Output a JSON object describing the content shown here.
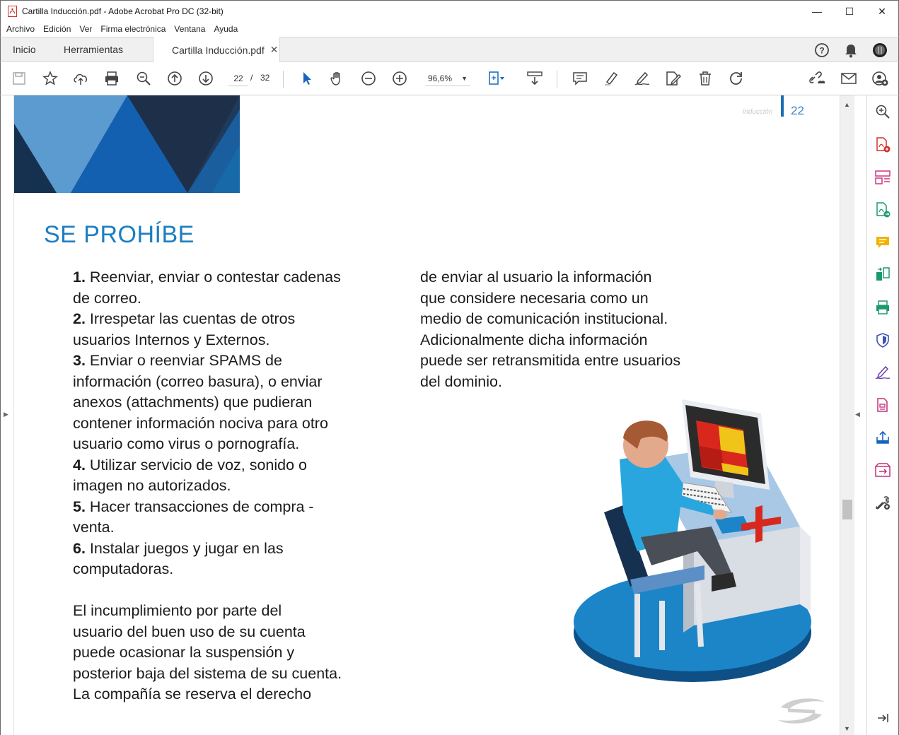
{
  "window": {
    "title": "Cartilla Inducción.pdf - Adobe Acrobat Pro DC (32-bit)",
    "minimize": "—",
    "maximize": "☐",
    "close": "✕"
  },
  "menu": [
    "Archivo",
    "Edición",
    "Ver",
    "Firma electrónica",
    "Ventana",
    "Ayuda"
  ],
  "tabs": {
    "home": "Inicio",
    "tools": "Herramientas",
    "document": "Cartilla Inducción.pdf",
    "close": "✕"
  },
  "toolbar": {
    "current_page": "22",
    "separator": "/",
    "total_pages": "32",
    "zoom": "96,6%",
    "zoom_caret": "▼"
  },
  "page": {
    "header_word": "inducción",
    "page_number": "22",
    "heading": "SE PROHÍBE",
    "list": [
      {
        "num": "1.",
        "text": " Reenviar, enviar o contestar cadenas\nde correo."
      },
      {
        "num": "2.",
        "text": " Irrespetar las cuentas de otros\nusuarios Internos y Externos."
      },
      {
        "num": "3.",
        "text": " Enviar o reenviar SPAMS de\ninformación (correo basura), o enviar\nanexos (attachments) que pudieran\ncontener información nociva para otro\nusuario como virus o pornografía."
      },
      {
        "num": "4.",
        "text": " Utilizar servicio de voz, sonido o\nimagen no autorizados."
      },
      {
        "num": "5.",
        "text": " Hacer transacciones de compra -\nventa."
      },
      {
        "num": "6.",
        "text": " Instalar juegos y jugar en las\ncomputadoras."
      }
    ],
    "closing_left": "El incumplimiento por parte del\nusuario del buen uso de su cuenta\npuede ocasionar la suspensión y\nposterior baja del sistema de su cuenta.\nLa compañía se reserva el derecho",
    "closing_right": "de enviar al usuario la información\nque considere necesaria como un\nmedio de comunicación institucional.\nAdicionalmente dicha información\npuede ser retransmitida entre usuarios\ndel dominio."
  },
  "scroll": {
    "up": "▲",
    "down": "▼",
    "left_collapse": "▶",
    "right_collapse": "◀"
  },
  "colors": {
    "heading": "#1b7ec2",
    "accent": "#1a6fb5",
    "acrobat_red": "#d4302b"
  }
}
